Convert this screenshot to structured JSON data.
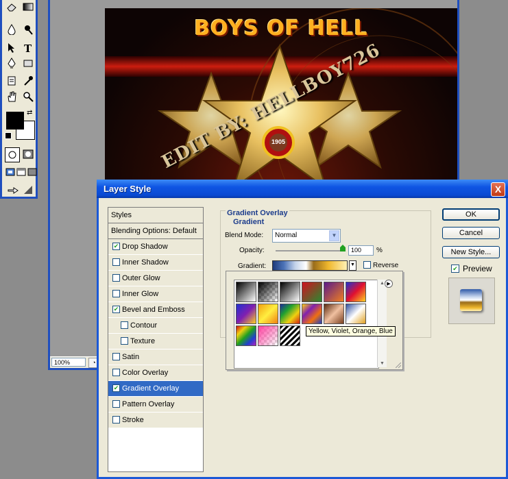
{
  "toolbox": {
    "tools": [
      "eraser-tool",
      "gradient-tool",
      "blur-tool",
      "dodge-tool",
      "path-select-tool",
      "type-tool",
      "pen-tool",
      "shape-tool",
      "notes-tool",
      "eyedropper-tool",
      "hand-tool",
      "zoom-tool"
    ]
  },
  "document": {
    "zoom": "100%"
  },
  "artwork": {
    "title": "BOYS OF HELL",
    "signature": "EDIT BY: HELLBOY726",
    "badge_year": "1905"
  },
  "dialog": {
    "title": "Layer Style",
    "close_label": "X",
    "styles_header": "Styles",
    "blending_options": "Blending Options: Default",
    "style_items": [
      {
        "label": "Drop Shadow",
        "checked": true
      },
      {
        "label": "Inner Shadow",
        "checked": false
      },
      {
        "label": "Outer Glow",
        "checked": false
      },
      {
        "label": "Inner Glow",
        "checked": false
      },
      {
        "label": "Bevel and Emboss",
        "checked": true
      },
      {
        "label": "Contour",
        "checked": false
      },
      {
        "label": "Texture",
        "checked": false
      },
      {
        "label": "Satin",
        "checked": false
      },
      {
        "label": "Color Overlay",
        "checked": false
      },
      {
        "label": "Gradient Overlay",
        "checked": true,
        "selected": true
      },
      {
        "label": "Pattern Overlay",
        "checked": false
      },
      {
        "label": "Stroke",
        "checked": false
      }
    ],
    "panel": {
      "section_title": "Gradient Overlay",
      "subsection_title": "Gradient",
      "blend_mode_label": "Blend Mode:",
      "blend_mode_value": "Normal",
      "opacity_label": "Opacity:",
      "opacity_value": "100",
      "opacity_unit": "%",
      "gradient_label": "Gradient:",
      "reverse_label": "Reverse"
    },
    "picker": {
      "tooltip": "Yellow, Violet, Orange, Blue",
      "swatch_count": 15
    },
    "buttons": {
      "ok": "OK",
      "cancel": "Cancel",
      "new_style": "New Style...",
      "preview": "Preview"
    },
    "colors": {
      "title_bar": "#0a4ad2",
      "selection": "#316ac5"
    }
  }
}
